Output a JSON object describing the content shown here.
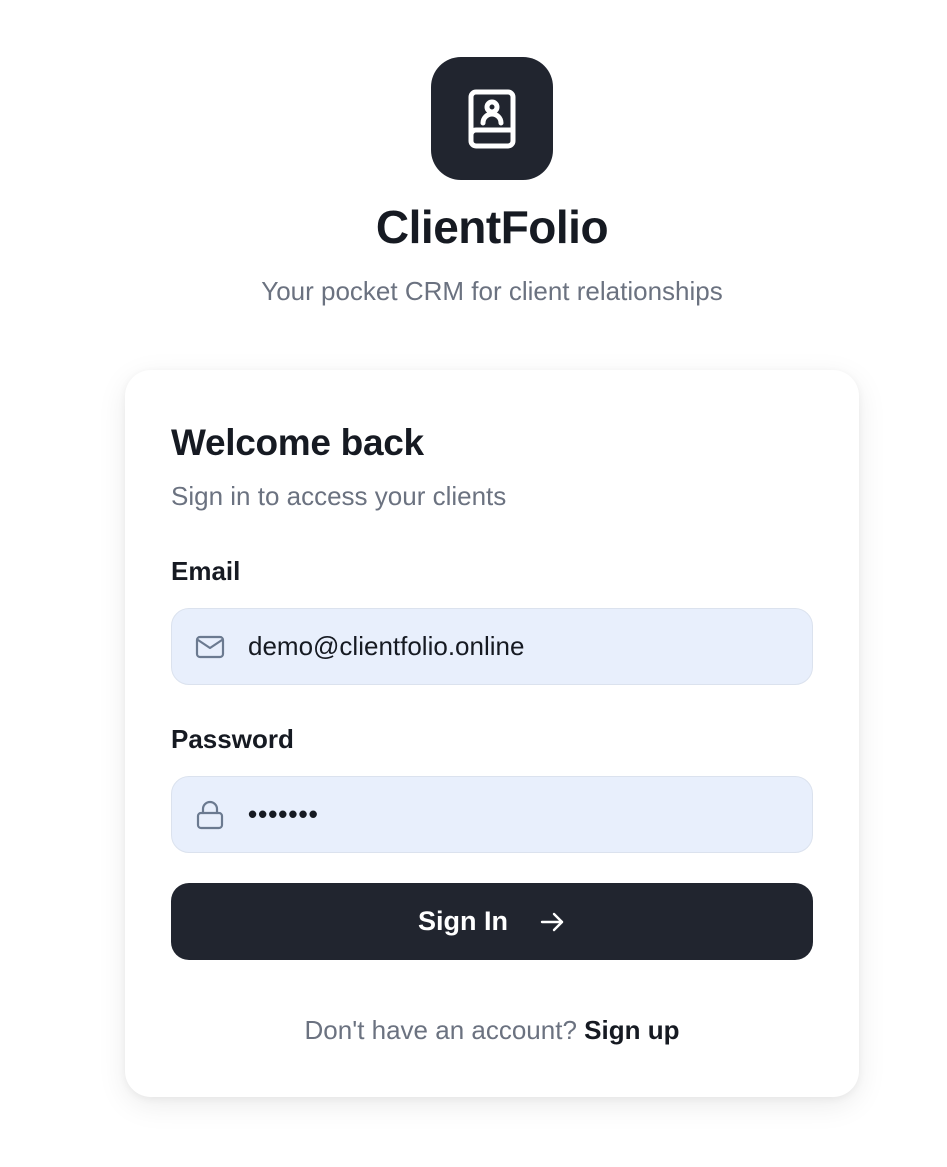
{
  "app": {
    "title": "ClientFolio",
    "subtitle": "Your pocket CRM for client relationships",
    "logo_icon": "contact-book-icon"
  },
  "card": {
    "title": "Welcome back",
    "subtitle": "Sign in to access your clients"
  },
  "form": {
    "email": {
      "label": "Email",
      "value": "demo@clientfolio.online",
      "icon": "mail-icon"
    },
    "password": {
      "label": "Password",
      "masked_value": "•••••••",
      "icon": "lock-icon"
    },
    "submit": {
      "label": "Sign In",
      "icon": "arrow-right-icon"
    }
  },
  "footer": {
    "prompt": "Don't have an account?",
    "link": "Sign up"
  },
  "colors": {
    "primary": "#21252f",
    "input_bg": "#e8effc",
    "muted_text": "#6b7280"
  }
}
